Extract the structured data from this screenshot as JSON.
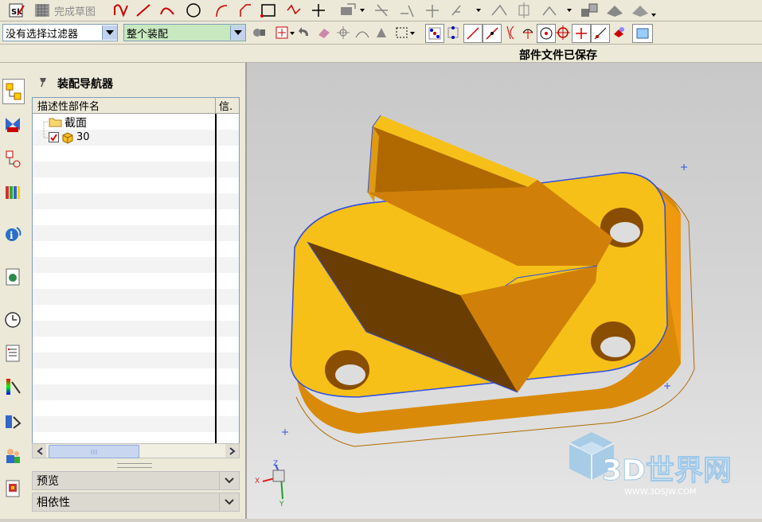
{
  "toolbar1": {
    "finish_sketch_label": "完成草图"
  },
  "toolbar2": {
    "filter_select": "没有选择过滤器",
    "scope_select": "整个装配"
  },
  "status": {
    "message": "部件文件已保存"
  },
  "navigator": {
    "title": "装配导航器",
    "columns": [
      "描述性部件名",
      "信."
    ],
    "tree": [
      {
        "label": "截面",
        "icon": "folder-icon"
      },
      {
        "label": "30",
        "icon": "part-icon",
        "checked": true
      }
    ]
  },
  "panels": {
    "preview": "预览",
    "dependencies": "相依性"
  },
  "viewport": {
    "triad": {
      "x": "X",
      "y": "Y",
      "z": "Z"
    },
    "watermark": {
      "brand": "3D世界网",
      "url": "WWW.3DSJW.COM"
    }
  },
  "colors": {
    "part_face_top": "#f6c018",
    "part_face_mid": "#d98a08",
    "part_face_dark": "#6a3e02",
    "selection_edge": "#3050e0",
    "watermark": "#9fc8e8"
  }
}
